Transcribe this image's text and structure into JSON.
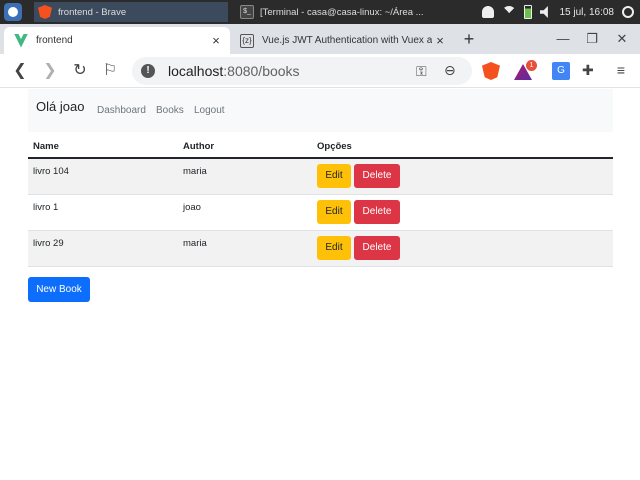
{
  "taskbar": {
    "tasks": [
      {
        "label": "frontend - Brave",
        "icon": "brave-icon"
      },
      {
        "label": "[Terminal - casa@casa-linux: ~/Área ...",
        "icon": "terminal-icon"
      }
    ],
    "clock": "15 jul, 16:08"
  },
  "browser": {
    "tabs": [
      {
        "title": "frontend",
        "icon": "vue-icon",
        "close": "×"
      },
      {
        "title": "Vue.js JWT Authentication with Vuex and Vu",
        "icon": "site-icon",
        "close": "×"
      }
    ],
    "new_tab": "+",
    "url_host": "localhost",
    "url_path": ":8080/books",
    "rewards_badge": "1"
  },
  "app": {
    "greeting": "Olá joao",
    "nav_links": [
      "Dashboard",
      "Books",
      "Logout"
    ],
    "table": {
      "headers": [
        "Name",
        "Author",
        "Opções"
      ],
      "rows": [
        {
          "name": "livro 104",
          "author": "maria"
        },
        {
          "name": "livro 1",
          "author": "joao"
        },
        {
          "name": "livro 29",
          "author": "maria"
        }
      ]
    },
    "edit_label": "Edit",
    "delete_label": "Delete",
    "new_book_label": "New Book"
  },
  "colors": {
    "edit_button": "#ffc107",
    "delete_button": "#dc3545",
    "new_button": "#0d6efd"
  }
}
